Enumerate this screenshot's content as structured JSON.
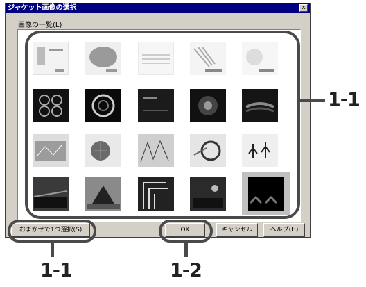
{
  "window": {
    "title": "ジャケット画像の選択",
    "close_label": "x"
  },
  "list": {
    "label": "画像の一覧(L)"
  },
  "buttons": {
    "random": "おまかせで1つ選択(S)",
    "ok": "OK",
    "cancel": "キャンセル",
    "help": "ヘルプ(H)"
  },
  "callouts": {
    "right": "1-1",
    "bottom_left": "1-1",
    "bottom_middle": "1-2"
  },
  "thumbnails": [
    {
      "name": "thumb-1"
    },
    {
      "name": "thumb-2"
    },
    {
      "name": "thumb-3"
    },
    {
      "name": "thumb-4"
    },
    {
      "name": "thumb-5"
    },
    {
      "name": "thumb-6"
    },
    {
      "name": "thumb-7"
    },
    {
      "name": "thumb-8"
    },
    {
      "name": "thumb-9"
    },
    {
      "name": "thumb-10"
    },
    {
      "name": "thumb-11"
    },
    {
      "name": "thumb-12"
    },
    {
      "name": "thumb-13"
    },
    {
      "name": "thumb-14"
    },
    {
      "name": "thumb-15"
    },
    {
      "name": "thumb-16"
    },
    {
      "name": "thumb-17"
    },
    {
      "name": "thumb-18"
    },
    {
      "name": "thumb-19"
    },
    {
      "name": "thumb-20",
      "selected": true
    }
  ]
}
